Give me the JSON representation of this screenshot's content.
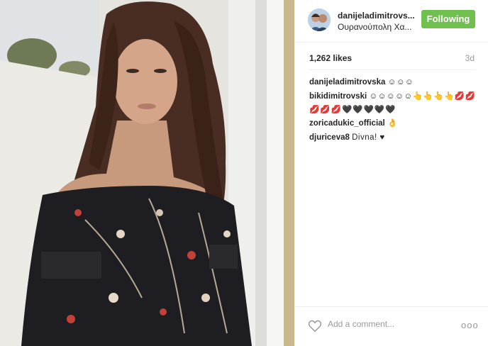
{
  "post": {
    "username": "danijeladimitrovs...",
    "location": "Ουρανούπολη Χα...",
    "follow_label": "Following",
    "likes": "1,262 likes",
    "time_ago": "3d",
    "comment_placeholder": "Add a comment...",
    "more_label": "ooo",
    "accent_color": "#70c050"
  },
  "comments": [
    {
      "author": "danijeladimitrovska",
      "text": "☺☺☺"
    },
    {
      "author": "bikidimitrovski",
      "text": "☺☺☺☺☺👆👆👆👆💋💋",
      "text_line2": "💋💋💋🖤🖤🖤🖤🖤"
    },
    {
      "author": "zoricadukic_official",
      "text": "👌"
    },
    {
      "author": "djuriceva8",
      "text": "Divna! ♥"
    }
  ],
  "icons": {
    "like": "heart-outline-icon",
    "more": "more-options-icon"
  }
}
